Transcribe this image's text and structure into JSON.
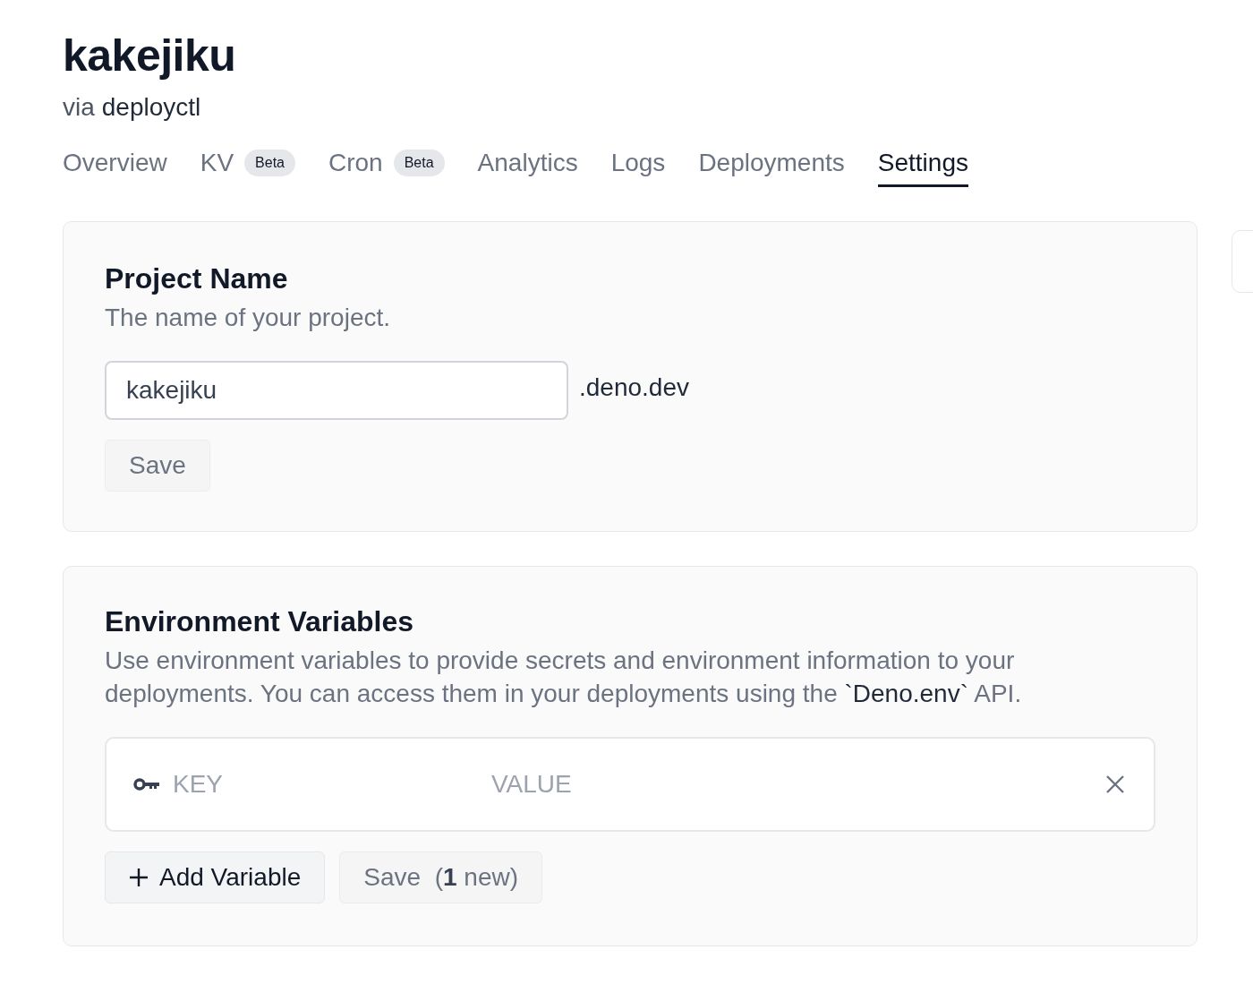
{
  "project": {
    "title": "kakejiku",
    "via_label": "via",
    "via_value": "deployctl"
  },
  "tabs": [
    {
      "label": "Overview",
      "selected": false
    },
    {
      "label": "KV",
      "badge": "Beta",
      "selected": false
    },
    {
      "label": "Cron",
      "badge": "Beta",
      "selected": false
    },
    {
      "label": "Analytics",
      "selected": false
    },
    {
      "label": "Logs",
      "selected": false
    },
    {
      "label": "Deployments",
      "selected": false
    },
    {
      "label": "Settings",
      "selected": true
    }
  ],
  "project_name": {
    "title": "Project Name",
    "description": "The name of your project.",
    "value": "kakejiku",
    "suffix": ".deno.dev",
    "save_button": {
      "label": "Save",
      "disabled": true
    }
  },
  "environment_variables": {
    "title": "Environment Variables",
    "description": "Use environment variables to provide secrets and environment information to your deployments. You can access them in your deployments using the **`Deno.env`** API.",
    "rows": [
      {
        "key_placeholder": "KEY",
        "value_placeholder": "VALUE"
      }
    ],
    "add_button": {
      "label": "Add Variable"
    },
    "save_button": {
      "label": "Save  (**1** new)",
      "disabled": true
    }
  }
}
